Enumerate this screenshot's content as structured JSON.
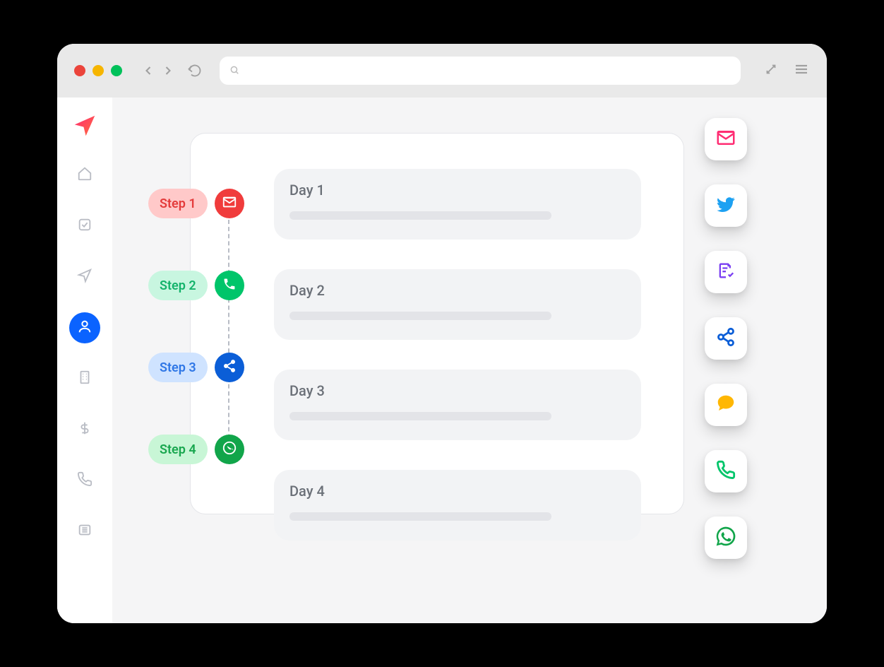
{
  "colors": {
    "red": "#f04747",
    "pink": "#ff2d73",
    "green": "#00c56a",
    "blue": "#0b63ff",
    "deepgreen": "#11a54a",
    "twitter": "#1da1f2",
    "purple": "#7b3ff2",
    "orange": "#ffb703"
  },
  "steps": [
    {
      "label": "Step 1",
      "pill_bg": "#ffc9c9",
      "pill_text": "#e43b3b",
      "circle_bg": "#f03c3c",
      "icon": "envelope"
    },
    {
      "label": "Step 2",
      "pill_bg": "#c8f6e0",
      "pill_text": "#14b36b",
      "circle_bg": "#00c56a",
      "icon": "phone"
    },
    {
      "label": "Step 3",
      "pill_bg": "#cfe3ff",
      "pill_text": "#2f77e6",
      "circle_bg": "#0b5ed7",
      "icon": "share"
    },
    {
      "label": "Step 4",
      "pill_bg": "#c8f6d6",
      "pill_text": "#19a74f",
      "circle_bg": "#11a54a",
      "icon": "whatsapp"
    }
  ],
  "days": [
    {
      "title": "Day 1"
    },
    {
      "title": "Day 2"
    },
    {
      "title": "Day 3"
    },
    {
      "title": "Day 4"
    }
  ],
  "sidebar": {
    "items": [
      {
        "icon": "home"
      },
      {
        "icon": "check-square"
      },
      {
        "icon": "send"
      },
      {
        "icon": "user",
        "active": true
      },
      {
        "icon": "building"
      },
      {
        "icon": "dollar"
      },
      {
        "icon": "phone-out"
      },
      {
        "icon": "list"
      }
    ]
  },
  "right_chips": [
    {
      "icon": "envelope",
      "color": "#ff2d73"
    },
    {
      "icon": "twitter",
      "color": "#1da1f2"
    },
    {
      "icon": "form",
      "color": "#7b3ff2"
    },
    {
      "icon": "share",
      "color": "#0b5ed7"
    },
    {
      "icon": "chat",
      "color": "#ffb703"
    },
    {
      "icon": "phone",
      "color": "#00c56a"
    },
    {
      "icon": "whatsapp",
      "color": "#11a54a"
    }
  ]
}
